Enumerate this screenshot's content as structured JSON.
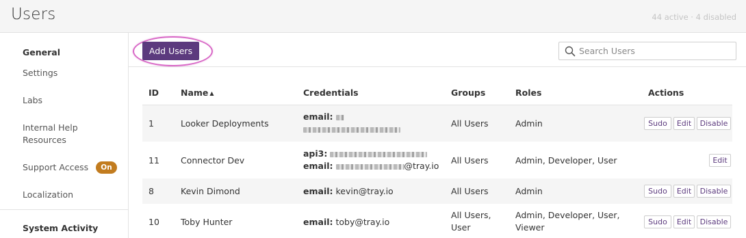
{
  "header": {
    "title": "Users",
    "summary": "44 active · 4 disabled"
  },
  "sidebar": {
    "general_title": "General",
    "items": [
      {
        "label": "Settings"
      },
      {
        "label": "Labs"
      },
      {
        "label": "Internal Help Resources"
      },
      {
        "label": "Support Access",
        "badge": "On"
      },
      {
        "label": "Localization"
      }
    ],
    "system_activity_title": "System Activity"
  },
  "toolbar": {
    "add_users_label": "Add Users",
    "search_placeholder": "Search Users",
    "search_value": ""
  },
  "table": {
    "columns": [
      "ID",
      "Name",
      "Credentials",
      "Groups",
      "Roles",
      "Actions"
    ],
    "sort_indicator": "▲",
    "rows": [
      {
        "id": "1",
        "name": "Looker Deployments",
        "cred1_label": "email:",
        "cred1_value": "",
        "cred2_label": "",
        "cred2_value": "",
        "groups": "All Users",
        "roles": "Admin",
        "actions": [
          "Sudo",
          "Edit",
          "Disable"
        ]
      },
      {
        "id": "11",
        "name": "Connector Dev",
        "cred1_label": "api3:",
        "cred1_value": "",
        "cred2_label": "email:",
        "cred2_value": "@tray.io",
        "groups": "All Users",
        "roles": "Admin, Developer, User",
        "actions": [
          "Edit"
        ]
      },
      {
        "id": "8",
        "name": "Kevin Dimond",
        "cred1_label": "email:",
        "cred1_value": "kevin@tray.io",
        "groups": "All Users",
        "roles": "Admin",
        "actions": [
          "Sudo",
          "Edit",
          "Disable"
        ]
      },
      {
        "id": "10",
        "name": "Toby Hunter",
        "cred1_label": "email:",
        "cred1_value": "toby@tray.io",
        "groups_line1": "All Users,",
        "groups_line2": "User",
        "roles_line1": "Admin, Developer, User,",
        "roles_line2": "Viewer",
        "actions": [
          "Sudo",
          "Edit",
          "Disable"
        ]
      }
    ]
  },
  "colors": {
    "primary_button": "#5c3a7e",
    "highlight_ring": "#d868c6",
    "badge_on": "#c27c1f"
  }
}
